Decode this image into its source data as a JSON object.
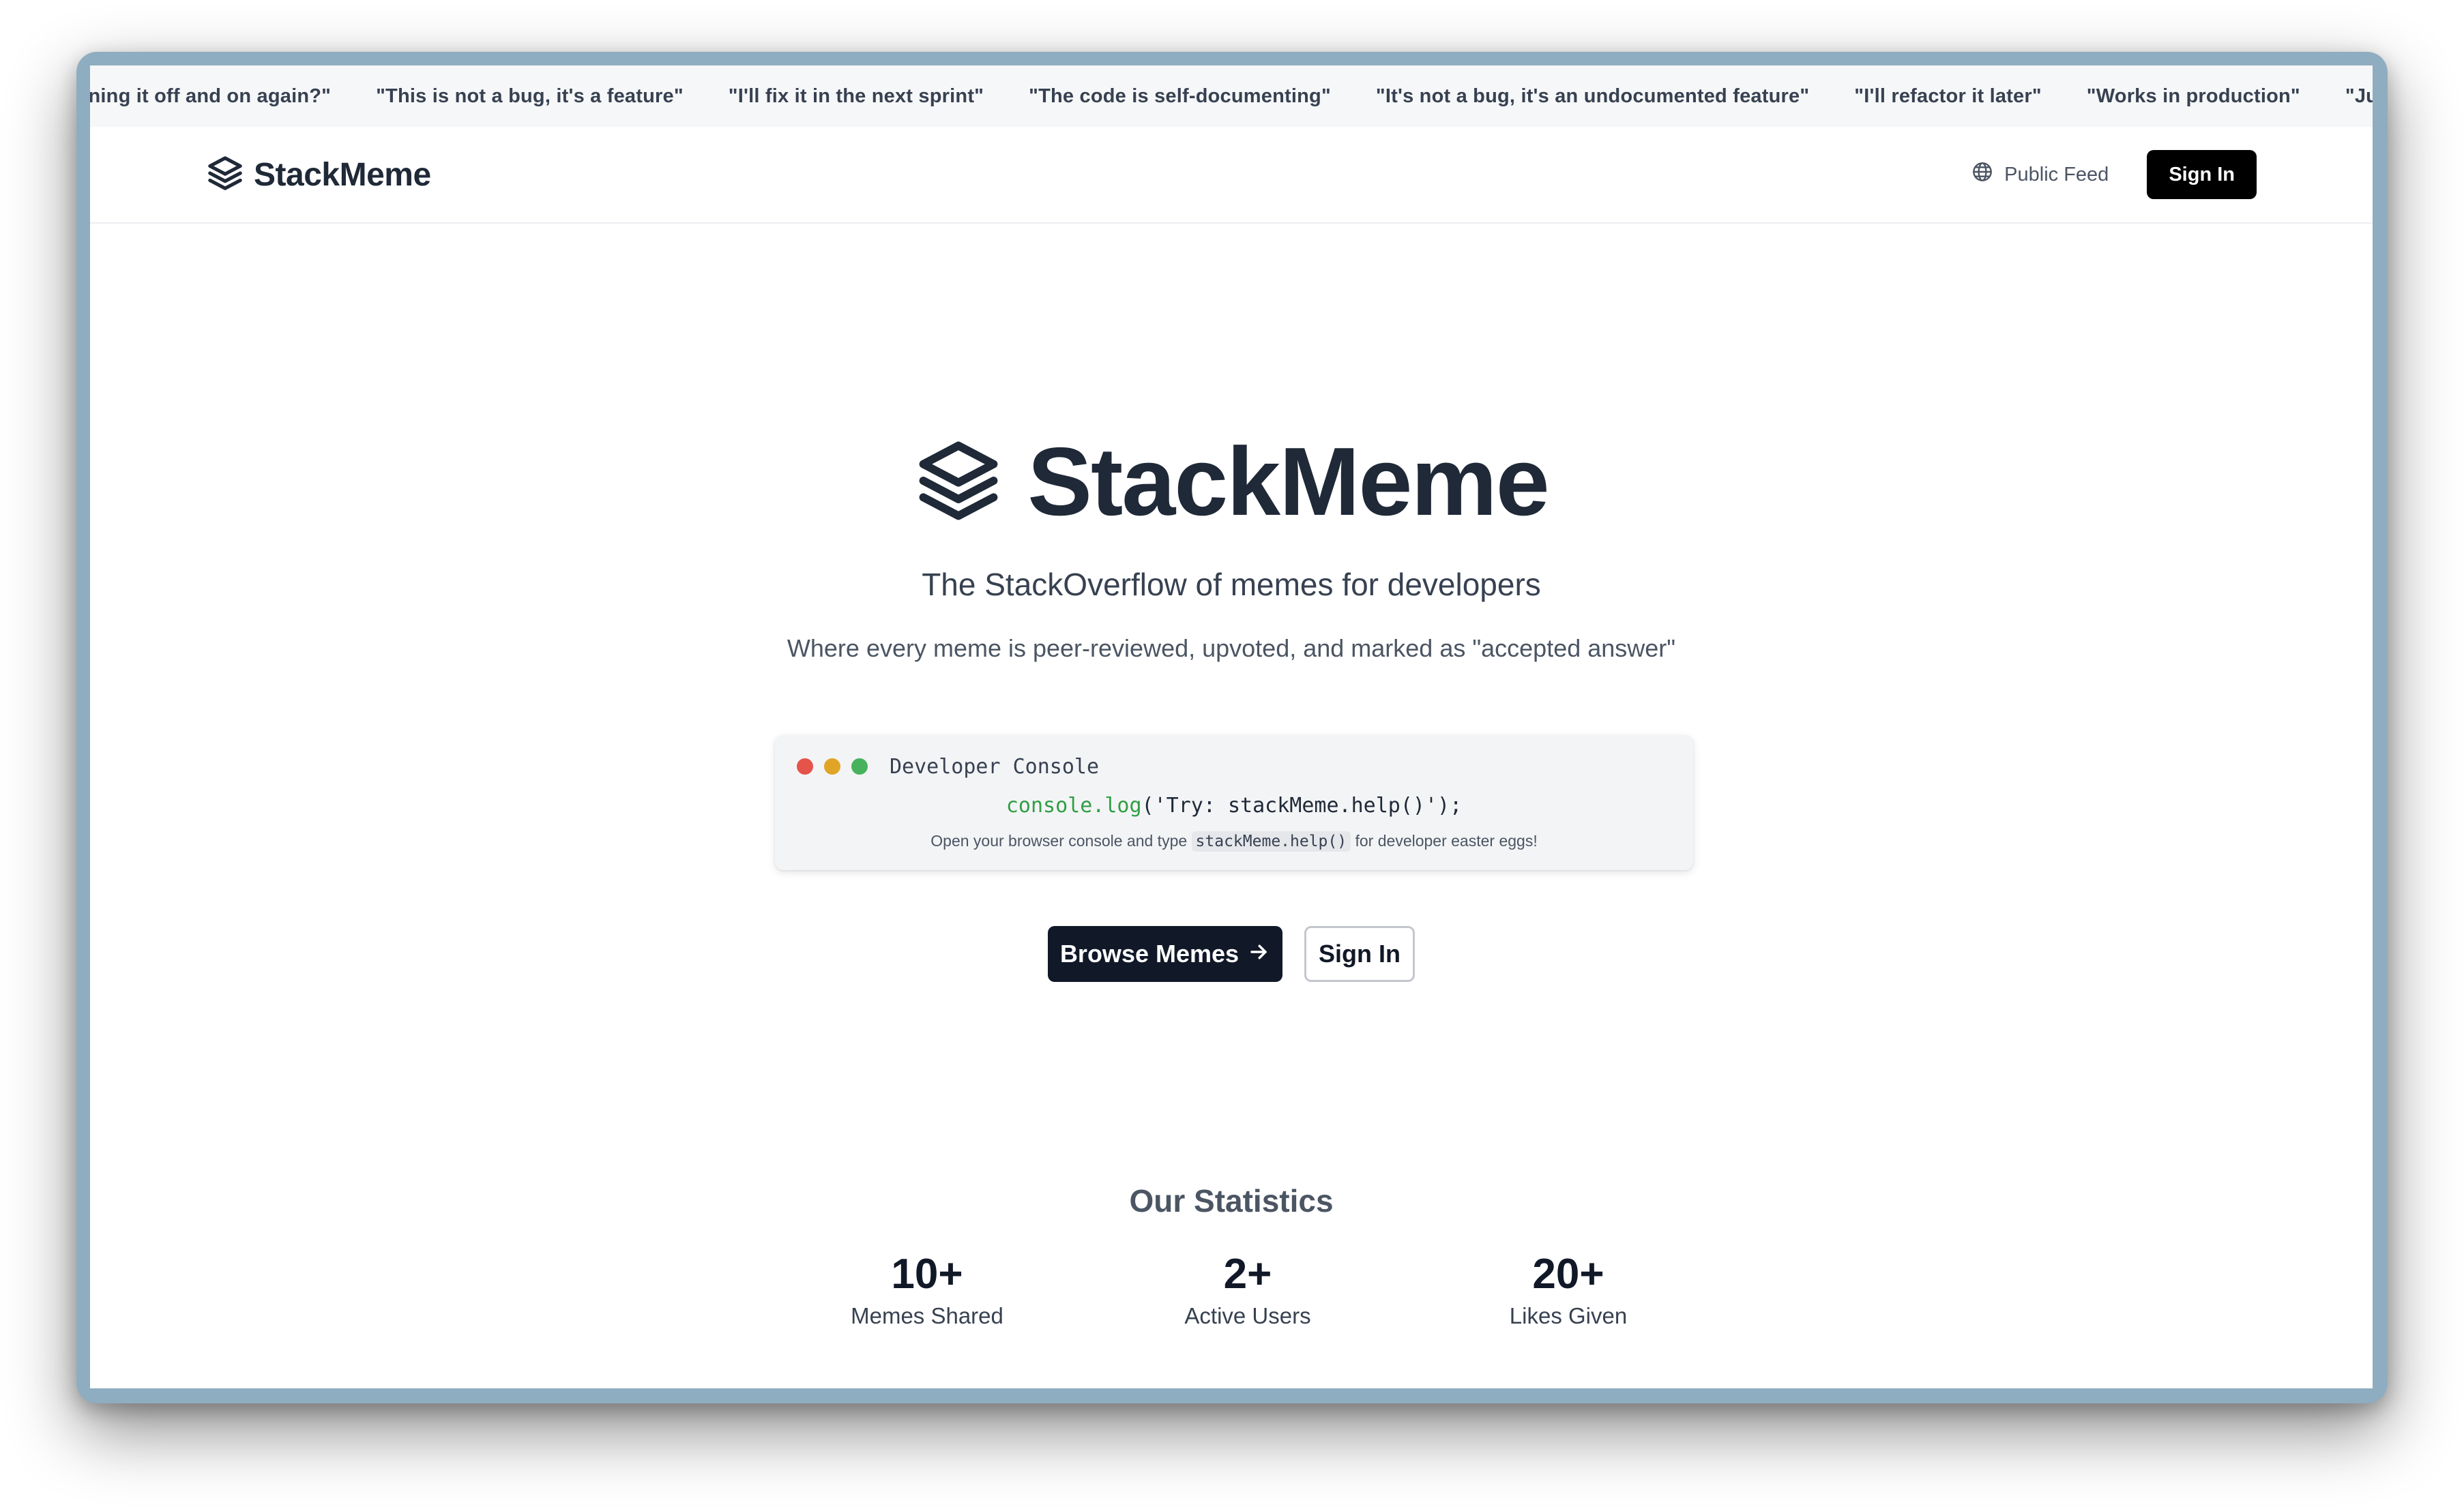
{
  "ticker": {
    "items": [
      "rning it off and on again?\"",
      "\"This is not a bug, it's a feature\"",
      "\"I'll fix it in the next sprint\"",
      "\"The code is self-documenting\"",
      "\"It's not a bug, it's an undocumented feature\"",
      "\"I'll refactor it later\"",
      "\"Works in production\"",
      "\"Just one more"
    ]
  },
  "navbar": {
    "brand": "StackMeme",
    "brand_icon": "layers-icon",
    "public_feed_label": "Public Feed",
    "public_feed_icon": "globe-icon",
    "sign_in_label": "Sign In"
  },
  "hero": {
    "title": "StackMeme",
    "tagline": "The StackOverflow of memes for developers",
    "subtitle": "Where every meme is peer-reviewed, upvoted, and marked as \"accepted answer\""
  },
  "console": {
    "title": "Developer Console",
    "code_fn": "console.log",
    "code_args": "('Try: stackMeme.help()');",
    "hint_before": "Open your browser console and type",
    "hint_code": "stackMeme.help()",
    "hint_after": "for developer easter eggs!",
    "dot_colors": [
      "#e5534b",
      "#e0a526",
      "#46b25c"
    ]
  },
  "cta": {
    "browse_label": "Browse Memes",
    "browse_icon": "arrow-right-icon",
    "sign_in_label": "Sign In"
  },
  "stats": {
    "title": "Our Statistics",
    "items": [
      {
        "value": "10+",
        "label": "Memes Shared"
      },
      {
        "value": "2+",
        "label": "Active Users"
      },
      {
        "value": "20+",
        "label": "Likes Given"
      }
    ]
  },
  "colors": {
    "primary_button": "#111827",
    "nav_button": "#000000",
    "code_accent": "#2f9e44"
  }
}
